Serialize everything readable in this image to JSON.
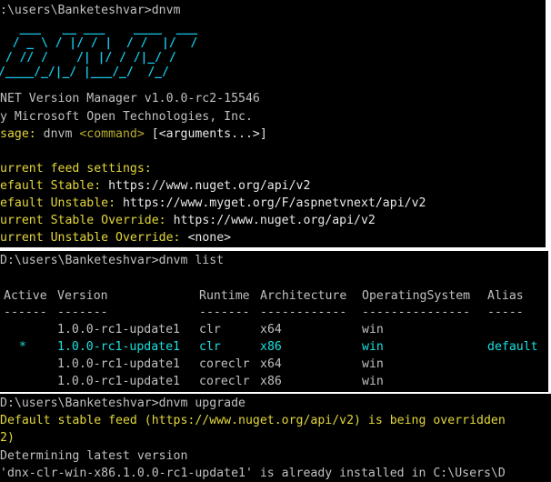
{
  "panel1": {
    "prompt": ":\\users\\Banketeshvar>dnvm",
    "logo": [
      "   ___   __ ___    ____  ___",
      "  / _ \\ / |/ / |  / /  |/  /",
      " / // /    /| |/ / /|_/ / ",
      "/____/_/|_/ |___/_/  /_/  "
    ],
    "version_line": "NET Version Manager v1.0.0-rc2-15546",
    "by_line": "y Microsoft Open Technologies, Inc.",
    "usage_label": "sage:",
    "usage_cmd": " dnvm ",
    "usage_command": "<command>",
    "usage_args": " [<arguments...>]",
    "feed_header": "urrent feed settings:",
    "default_stable_label": "efault Stable:",
    "default_stable_value": " https://www.nuget.org/api/v2",
    "default_unstable_label": "efault Unstable:",
    "default_unstable_value": " https://www.myget.org/F/aspnetvnext/api/v2",
    "current_stable_label": "urrent Stable Override:",
    "current_stable_value": " https://www.nuget.org/api/v2",
    "current_unstable_label": "urrent Unstable Override:",
    "current_unstable_value": " <none>"
  },
  "panel2": {
    "prompt": "D:\\users\\Banketeshvar>dnvm list",
    "headers": [
      "Active",
      "Version",
      "Runtime",
      "Architecture",
      "OperatingSystem",
      "Alias"
    ],
    "dashes": [
      "------",
      "-------",
      "-------",
      "------------",
      "---------------",
      "-----"
    ],
    "rows": [
      {
        "active": "",
        "version": "1.0.0-rc1-update1",
        "runtime": "clr",
        "arch": "x64",
        "os": "win",
        "alias": ""
      },
      {
        "active": "*",
        "version": "1.0.0-rc1-update1",
        "runtime": "clr",
        "arch": "x86",
        "os": "win",
        "alias": "default"
      },
      {
        "active": "",
        "version": "1.0.0-rc1-update1",
        "runtime": "coreclr",
        "arch": "x64",
        "os": "win",
        "alias": ""
      },
      {
        "active": "",
        "version": "1.0.0-rc1-update1",
        "runtime": "coreclr",
        "arch": "x86",
        "os": "win",
        "alias": ""
      }
    ]
  },
  "panel3": {
    "prompt": "D:\\users\\Banketeshvar>dnvm upgrade",
    "warning": "Default stable feed (https://www.nuget.org/api/v2) is being overridden",
    "warning_cont": "2)",
    "determining": "Determining latest version",
    "installed": "'dnx-clr-win-x86.1.0.0-rc1-update1' is already installed in C:\\Users\\D"
  },
  "colors": {
    "background": "#000000",
    "text": "#c0c0c0",
    "yellow": "#e3d63b",
    "cyan": "#19e0e0",
    "divider": "#ffffff"
  }
}
